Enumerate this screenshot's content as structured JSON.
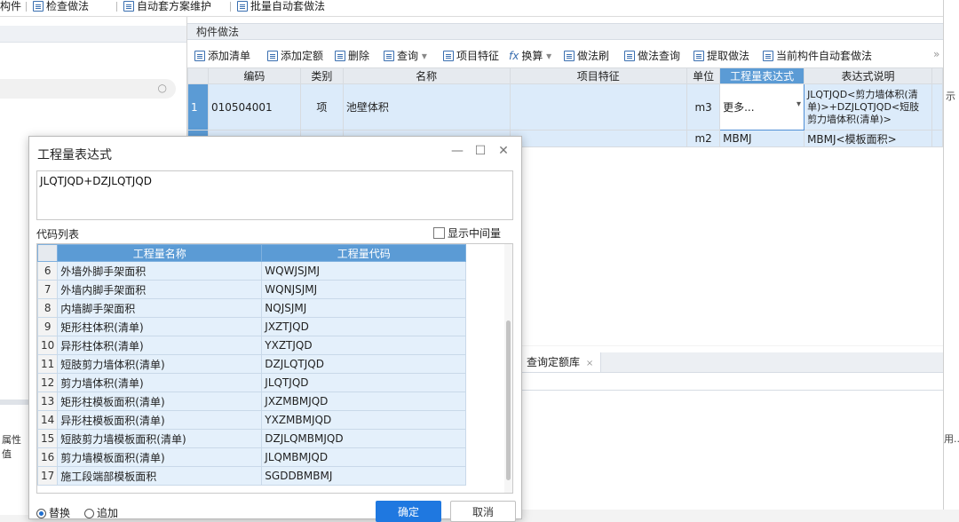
{
  "top_toolbar": {
    "items": [
      "构件",
      "检查做法",
      "自动套方案维护",
      "批量自动套做法"
    ]
  },
  "main_panel": {
    "title": "构件做法",
    "toolbar": [
      "添加清单",
      "添加定额",
      "删除",
      "查询",
      "项目特征",
      "换算",
      "做法刷",
      "做法查询",
      "提取做法",
      "当前构件自动套做法"
    ],
    "toolbar_more": "»",
    "columns": [
      "编码",
      "类别",
      "名称",
      "项目特征",
      "单位",
      "工程量表达式",
      "表达式说明"
    ],
    "rows": [
      {
        "num": "1",
        "code": "010504001",
        "type": "项",
        "name": "池壁体积",
        "feature": "",
        "unit": "m3",
        "expr": "更多...",
        "desc": "JLQTJQD<剪力墙体积(清单)>+DZJLQTJQD<短肢剪力墙体积(清单)>"
      },
      {
        "num": "",
        "code": "",
        "type": "",
        "name": "",
        "feature": "",
        "unit": "m2",
        "expr": "MBMJ",
        "desc": "MBMJ<模板面积>"
      }
    ]
  },
  "right_strip": {
    "top": "示",
    "bottom": "用..."
  },
  "lower_panel": {
    "tab": "查询定额库",
    "tab_close": "×"
  },
  "left_panel": {
    "prop_label": "属性值"
  },
  "dialog": {
    "title": "工程量表达式",
    "controls": {
      "minimize": "—",
      "maximize": "☐",
      "close": "✕"
    },
    "expression": "JLQTJQD+DZJLQTJQD",
    "code_list_label": "代码列表",
    "show_intermediate": "显示中间量",
    "columns": [
      "工程量名称",
      "工程量代码"
    ],
    "rows": [
      {
        "num": "6",
        "name": "外墙外脚手架面积",
        "code": "WQWJSJMJ"
      },
      {
        "num": "7",
        "name": "外墙内脚手架面积",
        "code": "WQNJSJMJ"
      },
      {
        "num": "8",
        "name": "内墙脚手架面积",
        "code": "NQJSJMJ"
      },
      {
        "num": "9",
        "name": "矩形柱体积(清单)",
        "code": "JXZTJQD"
      },
      {
        "num": "10",
        "name": "异形柱体积(清单)",
        "code": "YXZTJQD"
      },
      {
        "num": "11",
        "name": "短肢剪力墙体积(清单)",
        "code": "DZJLQTJQD"
      },
      {
        "num": "12",
        "name": "剪力墙体积(清单)",
        "code": "JLQTJQD"
      },
      {
        "num": "13",
        "name": "矩形柱模板面积(清单)",
        "code": "JXZMBMJQD"
      },
      {
        "num": "14",
        "name": "异形柱模板面积(清单)",
        "code": "YXZMBMJQD"
      },
      {
        "num": "15",
        "name": "短肢剪力墙模板面积(清单)",
        "code": "DZJLQMBMJQD"
      },
      {
        "num": "16",
        "name": "剪力墙模板面积(清单)",
        "code": "JLQMBMJQD"
      },
      {
        "num": "17",
        "name": "施工段端部模板面积",
        "code": "SGDDBMBMJ"
      }
    ],
    "replace_label": "替换",
    "append_label": "追加",
    "ok_label": "确定",
    "cancel_label": "取消"
  }
}
